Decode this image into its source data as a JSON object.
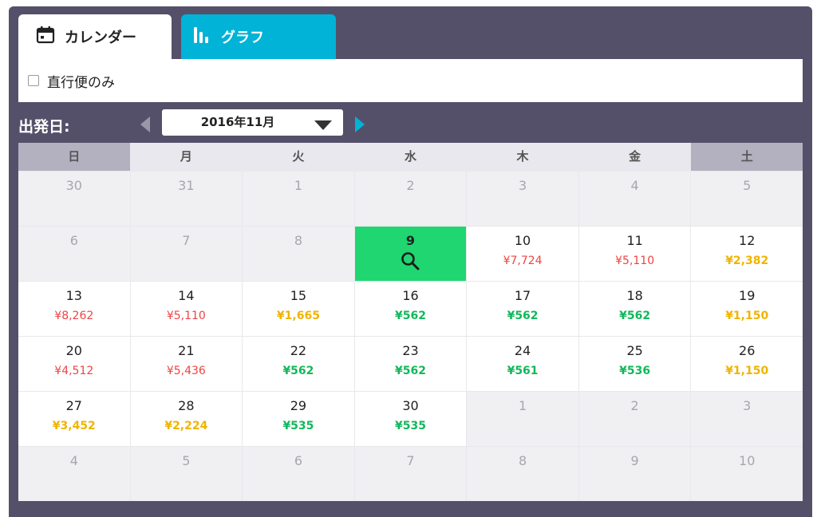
{
  "tabs": {
    "calendar_label": "カレンダー",
    "graph_label": "グラフ"
  },
  "filter": {
    "direct_only_label": "直行便のみ"
  },
  "date_nav": {
    "label": "出発日:",
    "month": "2016年11月"
  },
  "weekdays": [
    "日",
    "月",
    "火",
    "水",
    "木",
    "金",
    "土"
  ],
  "calendar": [
    {
      "day": "30",
      "out": true
    },
    {
      "day": "31",
      "out": true
    },
    {
      "day": "1",
      "out": true
    },
    {
      "day": "2",
      "out": true
    },
    {
      "day": "3",
      "out": true
    },
    {
      "day": "4",
      "out": true
    },
    {
      "day": "5",
      "out": true
    },
    {
      "day": "6",
      "out": true
    },
    {
      "day": "7",
      "out": true
    },
    {
      "day": "8",
      "out": true
    },
    {
      "day": "9",
      "selected": true
    },
    {
      "day": "10",
      "price": "¥7,724",
      "level": "expensive"
    },
    {
      "day": "11",
      "price": "¥5,110",
      "level": "expensive"
    },
    {
      "day": "12",
      "price": "¥2,382",
      "level": "mid"
    },
    {
      "day": "13",
      "price": "¥8,262",
      "level": "expensive"
    },
    {
      "day": "14",
      "price": "¥5,110",
      "level": "expensive"
    },
    {
      "day": "15",
      "price": "¥1,665",
      "level": "mid"
    },
    {
      "day": "16",
      "price": "¥562",
      "level": "cheap"
    },
    {
      "day": "17",
      "price": "¥562",
      "level": "cheap"
    },
    {
      "day": "18",
      "price": "¥562",
      "level": "cheap"
    },
    {
      "day": "19",
      "price": "¥1,150",
      "level": "mid"
    },
    {
      "day": "20",
      "price": "¥4,512",
      "level": "expensive"
    },
    {
      "day": "21",
      "price": "¥5,436",
      "level": "expensive"
    },
    {
      "day": "22",
      "price": "¥562",
      "level": "cheap"
    },
    {
      "day": "23",
      "price": "¥562",
      "level": "cheap"
    },
    {
      "day": "24",
      "price": "¥561",
      "level": "cheap"
    },
    {
      "day": "25",
      "price": "¥536",
      "level": "cheap"
    },
    {
      "day": "26",
      "price": "¥1,150",
      "level": "mid"
    },
    {
      "day": "27",
      "price": "¥3,452",
      "level": "mid"
    },
    {
      "day": "28",
      "price": "¥2,224",
      "level": "mid"
    },
    {
      "day": "29",
      "price": "¥535",
      "level": "cheap"
    },
    {
      "day": "30",
      "price": "¥535",
      "level": "cheap"
    },
    {
      "day": "1",
      "out": true
    },
    {
      "day": "2",
      "out": true
    },
    {
      "day": "3",
      "out": true
    },
    {
      "day": "4",
      "out": true
    },
    {
      "day": "5",
      "out": true
    },
    {
      "day": "6",
      "out": true
    },
    {
      "day": "7",
      "out": true
    },
    {
      "day": "8",
      "out": true
    },
    {
      "day": "9",
      "out": true
    },
    {
      "day": "10",
      "out": true
    }
  ],
  "colors": {
    "panel": "#55506a",
    "graph_tab": "#00b3d7",
    "selected_day": "#1fd670",
    "price_expensive": "#ee4444",
    "price_mid": "#f0b400",
    "price_cheap": "#12b85a"
  },
  "icons": {
    "calendar_tab": "calendar-icon",
    "graph_tab": "bar-chart-icon",
    "prev": "chevron-left-icon",
    "next": "chevron-right-icon",
    "dropdown": "caret-down-icon",
    "selected_day": "search-icon"
  }
}
